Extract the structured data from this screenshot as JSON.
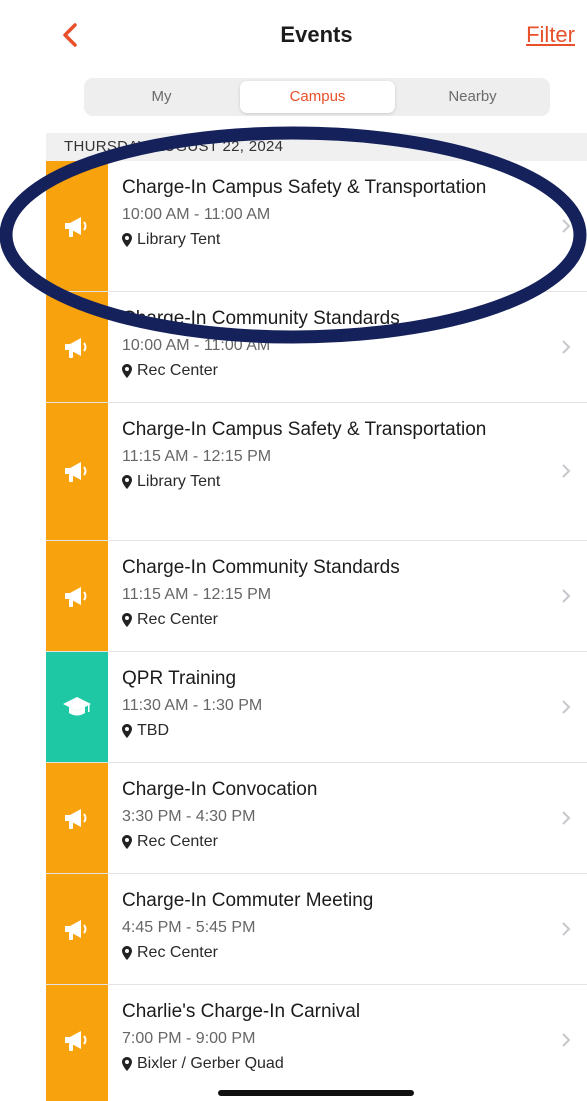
{
  "header": {
    "title": "Events",
    "filter_label": "Filter"
  },
  "tabs": [
    {
      "label": "My",
      "active": false
    },
    {
      "label": "Campus",
      "active": true
    },
    {
      "label": "Nearby",
      "active": false
    }
  ],
  "date_header": "THURSDAY, AUGUST 22, 2024",
  "events": [
    {
      "title": "Charge-In Campus Safety & Transportation",
      "time": "10:00 AM - 11:00 AM",
      "location": "Library Tent",
      "category_icon": "megaphone-icon",
      "category_color": "#f8a20e"
    },
    {
      "title": "Charge-In Community Standards",
      "time": "10:00 AM - 11:00 AM",
      "location": "Rec Center",
      "category_icon": "megaphone-icon",
      "category_color": "#f8a20e"
    },
    {
      "title": "Charge-In Campus Safety & Transportation",
      "time": "11:15 AM - 12:15 PM",
      "location": "Library Tent",
      "category_icon": "megaphone-icon",
      "category_color": "#f8a20e"
    },
    {
      "title": "Charge-In Community Standards",
      "time": "11:15 AM - 12:15 PM",
      "location": "Rec Center",
      "category_icon": "megaphone-icon",
      "category_color": "#f8a20e"
    },
    {
      "title": "QPR Training",
      "time": "11:30 AM - 1:30 PM",
      "location": "TBD",
      "category_icon": "graduation-cap-icon",
      "category_color": "#1ec8a5"
    },
    {
      "title": "Charge-In Convocation",
      "time": "3:30 PM - 4:30 PM",
      "location": "Rec Center",
      "category_icon": "megaphone-icon",
      "category_color": "#f8a20e"
    },
    {
      "title": "Charge-In Commuter Meeting",
      "time": "4:45 PM - 5:45 PM",
      "location": "Rec Center",
      "category_icon": "megaphone-icon",
      "category_color": "#f8a20e"
    },
    {
      "title": "Charlie's Charge-In Carnival",
      "time": "7:00 PM - 9:00 PM",
      "location": "Bixler / Gerber Quad",
      "category_icon": "megaphone-icon",
      "category_color": "#f8a20e"
    }
  ],
  "colors": {
    "accent": "#e8502a",
    "highlight_ring": "#14215a"
  }
}
